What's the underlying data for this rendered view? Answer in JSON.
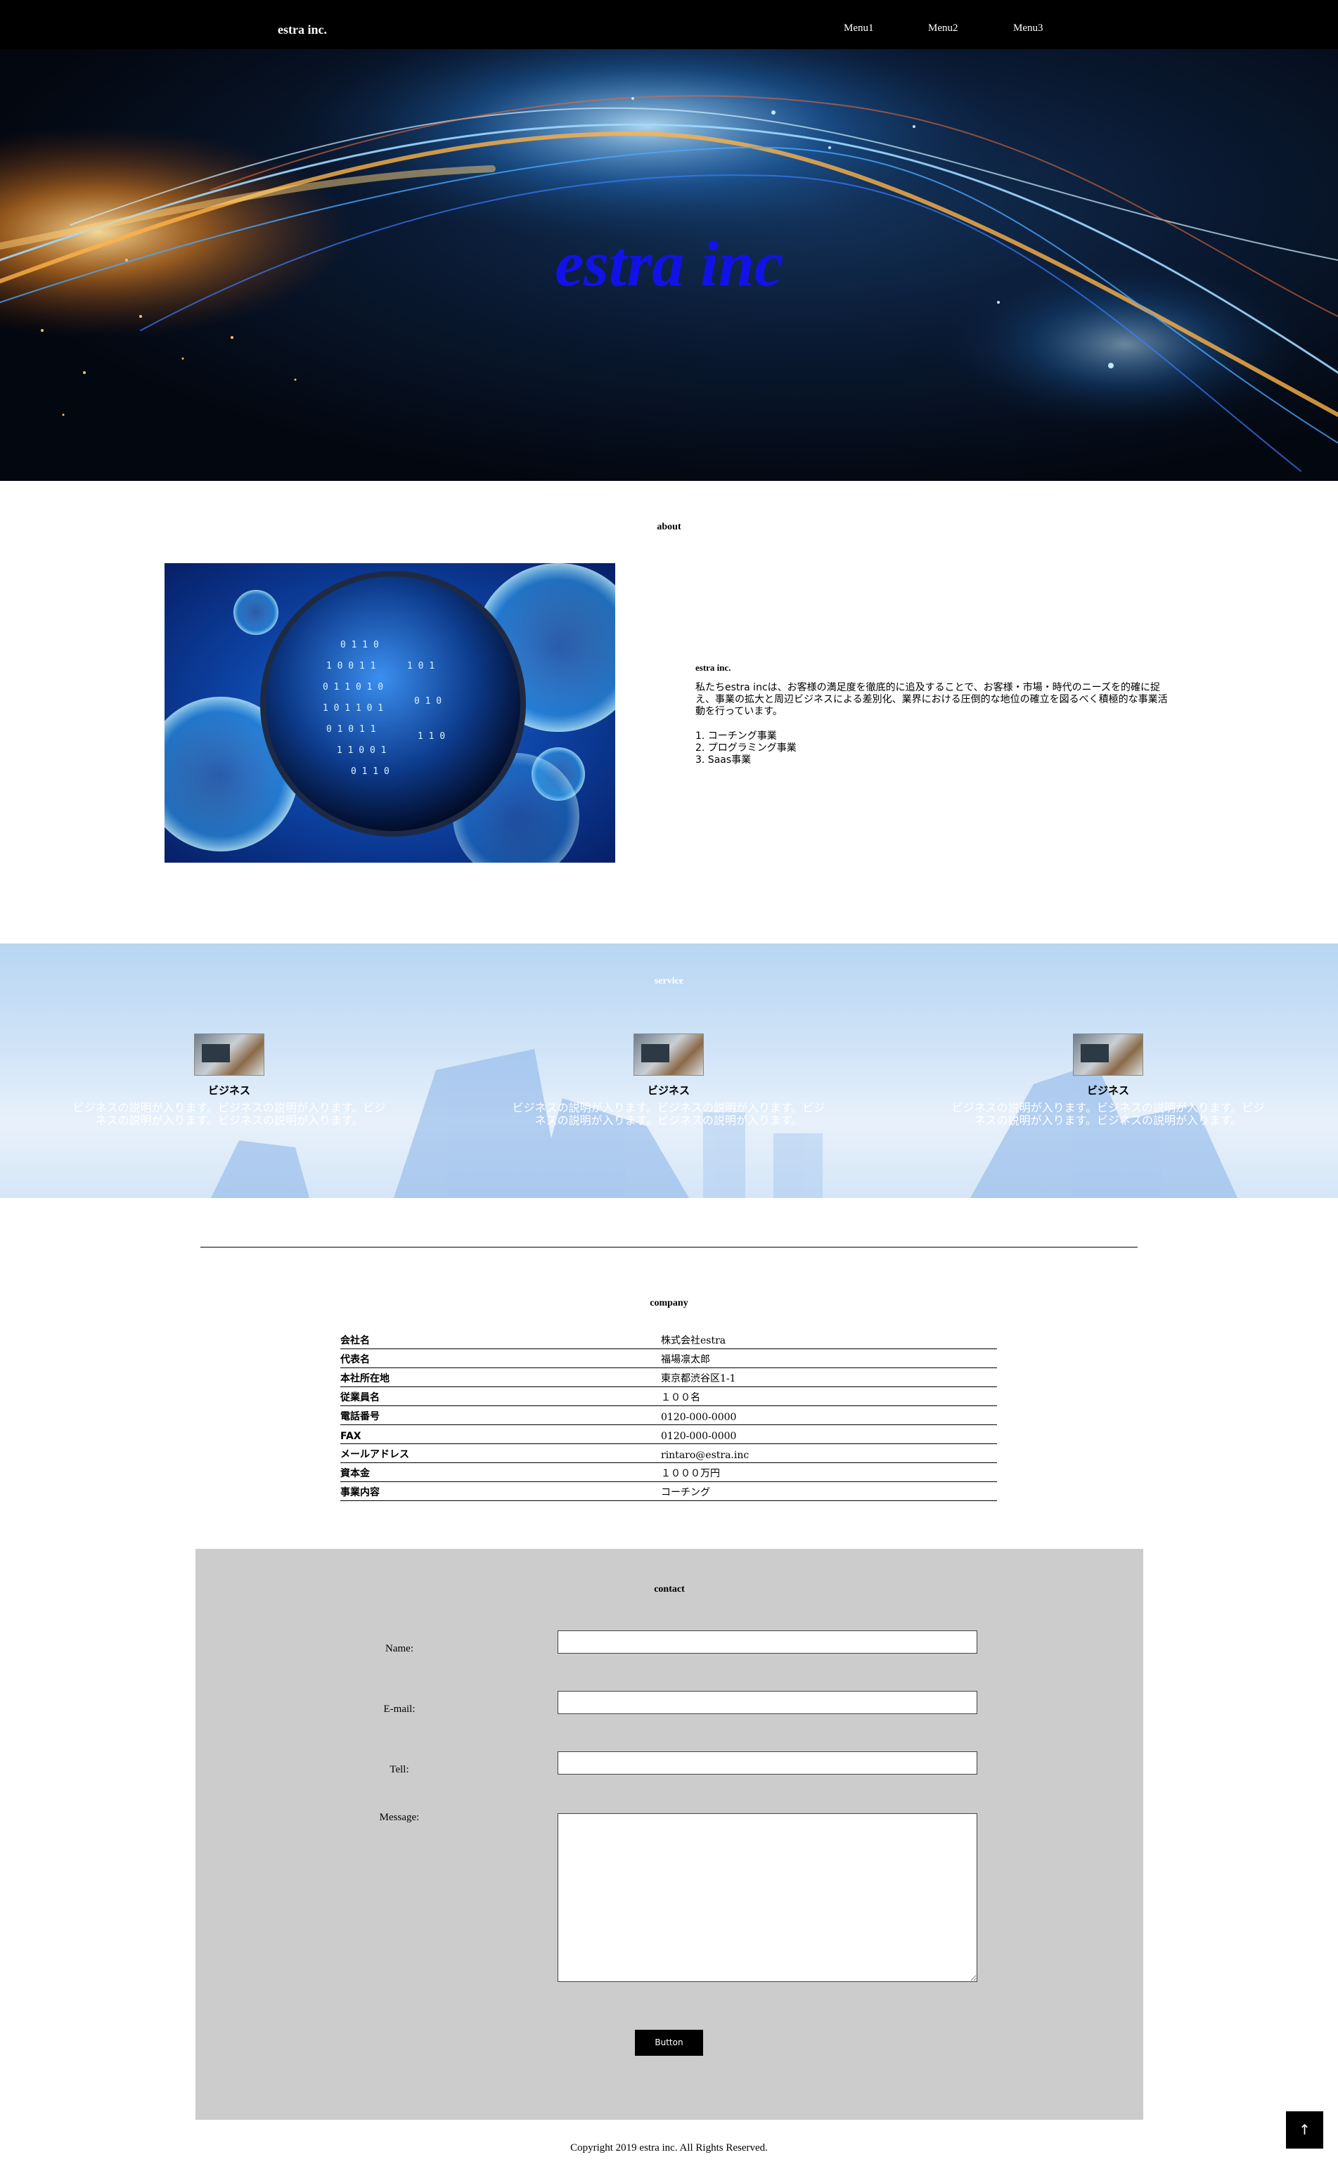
{
  "header": {
    "logo": "estra inc.",
    "menu": [
      "Menu1",
      "Menu2",
      "Menu3"
    ]
  },
  "hero": {
    "title": "estra inc"
  },
  "about": {
    "title": "about",
    "company": "estra inc.",
    "description": "私たちestra incは、お客様の満足度を徹底的に追及することで、お客様・市場・時代のニーズを的確に捉え、事業の拡大と周辺ビジネスによる差別化、業界における圧倒的な地位の確立を図るべく積極的な事業活動を行っています。",
    "services": [
      "1. コーチング事業",
      "2. プログラミング事業",
      "3. Saas事業"
    ]
  },
  "service": {
    "title": "service",
    "cards": [
      {
        "title": "ビジネス",
        "desc": "ビジネスの説明が入ります。ビジネスの説明が入ります。ビジネスの説明が入ります。ビジネスの説明が入ります。"
      },
      {
        "title": "ビジネス",
        "desc": "ビジネスの説明が入ります。ビジネスの説明が入ります。ビジネスの説明が入ります。ビジネスの説明が入ります。"
      },
      {
        "title": "ビジネス",
        "desc": "ビジネスの説明が入ります。ビジネスの説明が入ります。ビジネスの説明が入ります。ビジネスの説明が入ります。"
      }
    ]
  },
  "company": {
    "title": "company",
    "rows": [
      {
        "k": "会社名",
        "v": "株式会社estra"
      },
      {
        "k": "代表名",
        "v": "福場凛太郎"
      },
      {
        "k": "本社所在地",
        "v": "東京都渋谷区1-1"
      },
      {
        "k": "従業員名",
        "v": "１００名"
      },
      {
        "k": "電話番号",
        "v": "0120-000-0000"
      },
      {
        "k": "FAX",
        "v": "0120-000-0000"
      },
      {
        "k": "メールアドレス",
        "v": "rintaro@estra.inc"
      },
      {
        "k": "資本金",
        "v": "１０００万円"
      },
      {
        "k": "事業内容",
        "v": "コーチング"
      }
    ]
  },
  "contact": {
    "title": "contact",
    "name_label": "Name:",
    "email_label": "E-mail:",
    "tell_label": "Tell:",
    "message_label": "Message:",
    "button": "Button"
  },
  "footer": {
    "copyright": "Copyright 2019 estra inc. All Rights Reserved."
  },
  "totop": {
    "icon": "↑"
  }
}
